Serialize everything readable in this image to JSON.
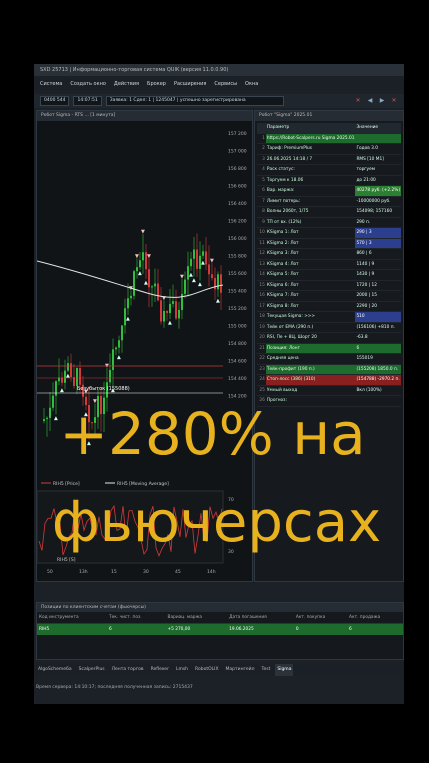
{
  "window": {
    "title": "SXD 25713 | Информационно-торговая система QUIK (версия 11.0.0.90)"
  },
  "menu": [
    "Система",
    "Создать окно",
    "Действия",
    "Брокер",
    "Расширения",
    "Сервисы",
    "Окна"
  ],
  "toolbar": {
    "account": "0400 544",
    "time": "14:07:51",
    "message": "Заявка: 1 Сдел: 1 | 1245047 | успешно зарегистрирована"
  },
  "chart_panel": {
    "title": "Робот Sigma - RTS ... [1 минута]",
    "label_breakeven": "Безубыток (155088)",
    "legend_price": "RIH5 [Price]",
    "legend_ma": "RIH5 [Moving Average]",
    "legend_lower": "RIH5 [S]",
    "lower_axis_top": "70",
    "lower_axis_bot": "30",
    "x_ticks": [
      "50",
      "13h",
      "15",
      "30",
      "45",
      "14h"
    ],
    "price_ticks": [
      "157 200",
      "157 000",
      "156 800",
      "156 600",
      "156 400",
      "156 200",
      "156 000",
      "155 800",
      "155 600",
      "155 400",
      "155 200",
      "155 000",
      "154 800",
      "154 600",
      "154 400",
      "154 200"
    ]
  },
  "robot_panel": {
    "title": "Робот \"Sigma\" 2025.01",
    "col_param": "Параметр",
    "col_value": "Значение",
    "rows": [
      {
        "n": "1",
        "name": "https://Robot-Scalpers.ru Sigma 2025.01",
        "value": "",
        "style": "green-full"
      },
      {
        "n": "2",
        "name": "Тариф: PremiumPlus",
        "value": "Годов 3.0",
        "style": ""
      },
      {
        "n": "3",
        "name": "26.06.2025 14:18 / 7",
        "value": "RMS [10 M1]",
        "style": ""
      },
      {
        "n": "4",
        "name": "Раск статус:",
        "value": "торгуем",
        "style": ""
      },
      {
        "n": "5",
        "name": "Торгуем к 18.06",
        "value": "до 21:00",
        "style": ""
      },
      {
        "n": "6",
        "name": "Вар. маржа:",
        "value": "40278 руб. (+2.2%)",
        "style": "green"
      },
      {
        "n": "7",
        "name": "Лимит потерь:",
        "value": "-10000000 руб.",
        "style": ""
      },
      {
        "n": "8",
        "name": "Волны 20б0т, 1/75",
        "value": "154098; 157160",
        "style": ""
      },
      {
        "n": "9",
        "name": "ТП от вх. (12%)",
        "value": "290 п.",
        "style": ""
      },
      {
        "n": "10",
        "name": "КSigma 1: Лот",
        "value": "290 | 3",
        "style": "blue"
      },
      {
        "n": "11",
        "name": "КSigma 2: Лот",
        "value": "570 | 3",
        "style": "blue"
      },
      {
        "n": "12",
        "name": "КSigma 3: Лот",
        "value": "860 | 6",
        "style": ""
      },
      {
        "n": "13",
        "name": "КSigma 4: Лот",
        "value": "1140 | 9",
        "style": ""
      },
      {
        "n": "14",
        "name": "КSigma 5: Лот",
        "value": "1430 | 9",
        "style": ""
      },
      {
        "n": "15",
        "name": "КSigma 6: Лот",
        "value": "1720 | 12",
        "style": ""
      },
      {
        "n": "16",
        "name": "КSigma 7: Лот",
        "value": "2000 | 15",
        "style": ""
      },
      {
        "n": "17",
        "name": "КSigma 8: Лот",
        "value": "2290 | 20",
        "style": ""
      },
      {
        "n": "18",
        "name": "Текущая Sigma: >>>",
        "value": "510",
        "style": "blue"
      },
      {
        "n": "19",
        "name": "Тейк от ЕМА (290 п.)",
        "value": "(156106) +810 п.",
        "style": ""
      },
      {
        "n": "20",
        "name": "RSI, Пе + 8Ц, Шорт 20",
        "value": "-63.8",
        "style": ""
      },
      {
        "n": "21",
        "name": "Позиция: Лонг",
        "value": "6",
        "style": "green-full"
      },
      {
        "n": "22",
        "name": "Средняя цена",
        "value": "155019",
        "style": ""
      },
      {
        "n": "23",
        "name": "Тейк-профит (190 п.)",
        "value": "(155208) 1850.0 п.",
        "style": "green-full"
      },
      {
        "n": "24",
        "name": "Стоп-лосс (386) (310)",
        "value": "(154788) -2970.2 п.",
        "style": "red-full"
      },
      {
        "n": "25",
        "name": "Умный выход",
        "value": "Вкл (100%)",
        "style": ""
      },
      {
        "n": "26",
        "name": "Прогноз:",
        "value": "",
        "style": ""
      }
    ]
  },
  "positions": {
    "title": "Позиции по клиентским счетам (фьючерсы)",
    "columns": [
      "Код инструмента",
      "Тек. чист. поз.",
      "Вариац. маржа",
      "Дата погашения",
      "Акт. покупка",
      "Акт. продажа"
    ],
    "row": [
      "RIH5",
      "6",
      "+5 270,00",
      "19.06.2025",
      "0",
      "6"
    ]
  },
  "tabs": [
    "AlgoScheme6a",
    "ScalperPlus",
    "Лента торгов",
    "Reflexer",
    "Lmsh",
    "RobotOLIX",
    "Мартингейл",
    "Test",
    "Sigma"
  ],
  "active_tab": "Sigma",
  "status": "Время сервера: 14:10:17; последняя полученная запись: 2715437",
  "overlay": {
    "line1": "+280% на",
    "line2": "фьючерсах"
  }
}
